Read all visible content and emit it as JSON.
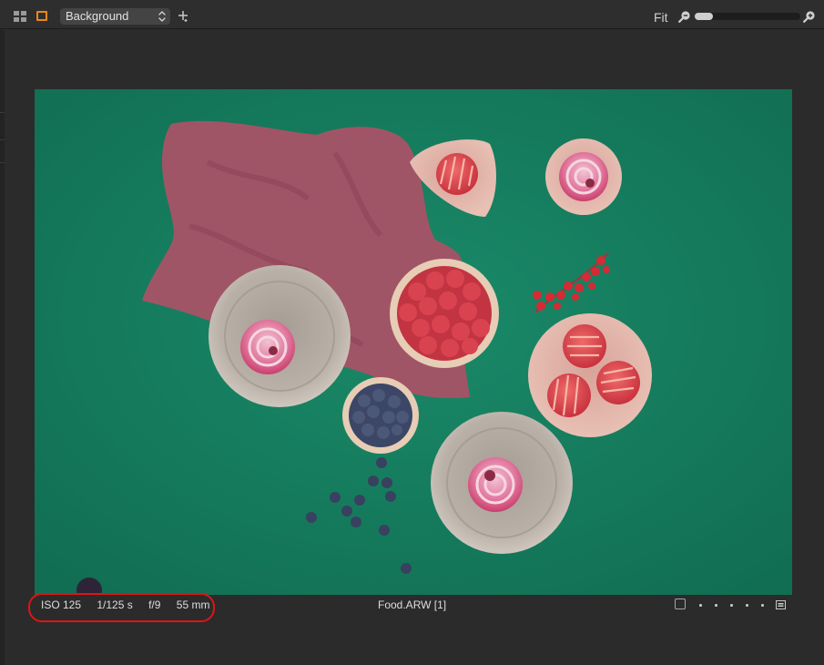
{
  "toolbar": {
    "variant_name": "Background",
    "zoom_label": "Fit",
    "zoom_level": 0.17,
    "icons": [
      "grid-view-icon",
      "single-view-icon",
      "chevron-updown-icon",
      "add-icon",
      "zoom-out-icon",
      "zoom-in-icon"
    ]
  },
  "colors": {
    "accent": "#e8891d",
    "highlight": "#e01414",
    "background": "#2b2b2b"
  },
  "footer": {
    "iso": "ISO 125",
    "shutter": "1/125 s",
    "aperture": "f/9",
    "focal_length": "55 mm",
    "filename": "Food.ARW [1]",
    "rating_stars": 0,
    "rating_max": 5
  }
}
